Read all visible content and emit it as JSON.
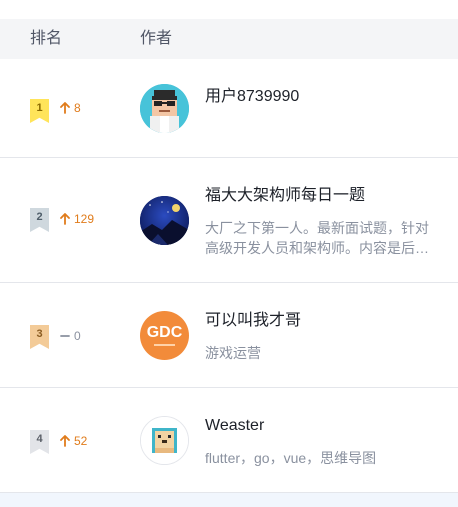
{
  "header": {
    "rank_label": "排名",
    "author_label": "作者"
  },
  "rows": [
    {
      "rank": "1",
      "trend": {
        "direction": "up",
        "icon": "arrow-up-icon",
        "value": "8"
      },
      "author": {
        "name": "用户8739990",
        "description": ""
      }
    },
    {
      "rank": "2",
      "trend": {
        "direction": "up",
        "icon": "arrow-up-icon",
        "value": "129"
      },
      "author": {
        "name": "福大大架构师每日一题",
        "description": "大厂之下第一人。最新面试题，针对高级开发人员和架构师。内容是后端和云原生，以go为主。"
      }
    },
    {
      "rank": "3",
      "trend": {
        "direction": "flat",
        "icon": "dash-icon",
        "value": "0"
      },
      "author": {
        "name": "可以叫我才哥",
        "description": "游戏运营",
        "avatar_text": "GDC"
      }
    },
    {
      "rank": "4",
      "trend": {
        "direction": "up",
        "icon": "arrow-up-icon",
        "value": "52"
      },
      "author": {
        "name": "Weaster",
        "description": "flutter，go，vue，思维导图"
      }
    }
  ],
  "colors": {
    "trend_up": "#e07c1c",
    "trend_flat": "#8a919f",
    "gold": "#ffe45a",
    "silver": "#cfd8de",
    "bronze": "#f3cb98"
  }
}
